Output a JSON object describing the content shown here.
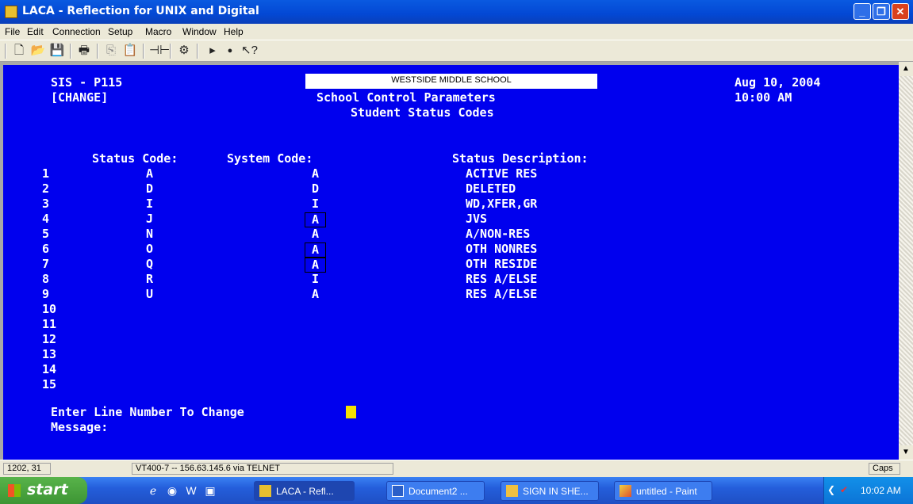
{
  "window": {
    "title": "LACA - Reflection for UNIX and Digital"
  },
  "menu": [
    "File",
    "Edit",
    "Connection",
    "Setup",
    "Macro",
    "Window",
    "Help"
  ],
  "terminal": {
    "program": "SIS - P115",
    "mode": "[CHANGE]",
    "school": "WESTSIDE MIDDLE SCHOOL",
    "heading1": "School Control Parameters",
    "heading2": "Student Status Codes",
    "date": "Aug 10, 2004",
    "time": "10:00 AM",
    "col_status": "Status Code:",
    "col_system": "System Code:",
    "col_desc": "Status Description:",
    "rows": [
      {
        "line": "1",
        "status": "A",
        "system": "A",
        "desc": "ACTIVE RES"
      },
      {
        "line": "2",
        "status": "D",
        "system": "D",
        "desc": "DELETED"
      },
      {
        "line": "3",
        "status": "I",
        "system": "I",
        "desc": "WD,XFER,GR"
      },
      {
        "line": "4",
        "status": "J",
        "system": "A",
        "desc": "JVS"
      },
      {
        "line": "5",
        "status": "N",
        "system": "A",
        "desc": "A/NON-RES"
      },
      {
        "line": "6",
        "status": "O",
        "system": "A",
        "desc": "OTH NONRES"
      },
      {
        "line": "7",
        "status": "Q",
        "system": "A",
        "desc": "OTH RESIDE"
      },
      {
        "line": "8",
        "status": "R",
        "system": "I",
        "desc": "RES A/ELSE"
      },
      {
        "line": "9",
        "status": "U",
        "system": "A",
        "desc": "RES A/ELSE"
      },
      {
        "line": "10"
      },
      {
        "line": "11"
      },
      {
        "line": "12"
      },
      {
        "line": "13"
      },
      {
        "line": "14"
      },
      {
        "line": "15"
      }
    ],
    "prompt": "Enter Line Number To Change",
    "message_label": "Message:"
  },
  "statusbar": {
    "cursor_pos": "1202, 31",
    "connection": "VT400-7 -- 156.63.145.6 via TELNET",
    "caps": "Caps"
  },
  "taskbar": {
    "start": "start",
    "tasks": [
      "LACA - Refl...",
      "Document2 ...",
      "SIGN IN SHE...",
      "untitled - Paint"
    ],
    "clock": "10:02 AM"
  },
  "colors": {
    "terminal_bg": "#0000ee",
    "cursor": "#f5e000"
  }
}
